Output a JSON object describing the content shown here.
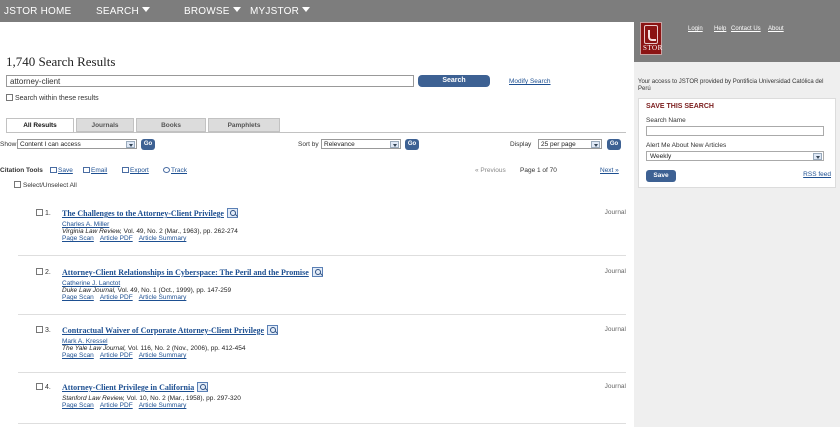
{
  "nav": {
    "home": "JSTOR HOME",
    "search": "SEARCH",
    "browse": "BROWSE",
    "myjstor": "MyJSTOR"
  },
  "right": {
    "logo_text": "STOR",
    "links": [
      "Login",
      "Help",
      "Contact Us",
      "About"
    ],
    "access_text": "Your access to JSTOR provided by Pontificia Universidad Católica del Perú",
    "save_title": "SAVE THIS SEARCH",
    "search_name_label": "Search Name",
    "search_name_value": "",
    "alert_label": "Alert Me About New Articles",
    "alert_value": "Weekly",
    "save_button": "Save",
    "rss": "RSS feed"
  },
  "results_title": "1,740 Search Results",
  "search": {
    "value": "attorney-client",
    "button": "Search",
    "modify": "Modify Search",
    "within": "Search within these results"
  },
  "tabs": [
    "All Results",
    "Journals",
    "Books",
    "Pamphlets"
  ],
  "filters": {
    "show_label": "Show",
    "show_value": "Content I can access",
    "go": "Go",
    "sort_label": "Sort by",
    "sort_value": "Relevance",
    "display_label": "Display",
    "display_value": "25 per page"
  },
  "tools": {
    "label": "Citation Tools",
    "save": "Save",
    "email": "Email",
    "export": "Export",
    "track": "Track",
    "select_all": "Select/Unselect All",
    "previous": "« Previous",
    "page": "Page 1 of 70",
    "next": "Next »"
  },
  "results": [
    {
      "num": "1.",
      "title": "The Challenges to the Attorney-Client Privilege",
      "author": "Charles A. Miller",
      "journal": "Virginia Law Review,",
      "cite": " Vol. 49, No. 2 (Mar., 1963), pp. 262-274",
      "links": [
        "Page Scan",
        "Article PDF",
        "Article Summary"
      ],
      "type": "Journal"
    },
    {
      "num": "2.",
      "title": "Attorney-Client Relationships in Cyberspace: The Peril and the Promise",
      "author": "Catherine J. Lanctot",
      "journal": "Duke Law Journal,",
      "cite": " Vol. 49, No. 1 (Oct., 1999), pp. 147-259",
      "links": [
        "Page Scan",
        "Article PDF",
        "Article Summary"
      ],
      "type": "Journal"
    },
    {
      "num": "3.",
      "title": "Contractual Waiver of Corporate Attorney-Client Privilege",
      "author": "Mark A. Kressel",
      "journal": "The Yale Law Journal,",
      "cite": " Vol. 116, No. 2 (Nov., 2006), pp. 412-454",
      "links": [
        "Page Scan",
        "Article PDF",
        "Article Summary"
      ],
      "type": "Journal"
    },
    {
      "num": "4.",
      "title": "Attorney-Client Privilege in California",
      "author": "",
      "journal": "Stanford Law Review,",
      "cite": " Vol. 10, No. 2 (Mar., 1958), pp. 297-320",
      "links": [
        "Page Scan",
        "Article PDF",
        "Article Summary"
      ],
      "type": "Journal"
    }
  ]
}
